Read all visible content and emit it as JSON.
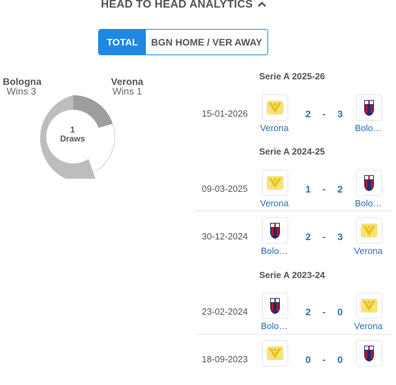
{
  "header": {
    "title": "HEAD TO HEAD ANALYTICS"
  },
  "tabs": [
    {
      "label": "TOTAL"
    },
    {
      "label": "BGN HOME / VER AWAY"
    }
  ],
  "summary": {
    "home": {
      "name": "Bologna",
      "wins": "Wins 3"
    },
    "away": {
      "name": "Verona",
      "wins": "Wins 1"
    },
    "draws": {
      "count": "1",
      "label": "Draws"
    }
  },
  "seasons": [
    {
      "name": "Serie A 2025-26"
    },
    {
      "name": "Serie A 2024-25"
    },
    {
      "name": "Serie A 2023-24"
    }
  ],
  "matches": [
    {
      "date": "15-01-2026",
      "home": "Verona",
      "away": "Bolo…",
      "home_score": "2",
      "away_score": "3",
      "dash": "-"
    },
    {
      "date": "09-03-2025",
      "home": "Verona",
      "away": "Bolo…",
      "home_score": "1",
      "away_score": "2",
      "dash": "-"
    },
    {
      "date": "30-12-2024",
      "home": "Bolo…",
      "away": "Verona",
      "home_score": "2",
      "away_score": "3",
      "dash": "-"
    },
    {
      "date": "23-02-2024",
      "home": "Bolo…",
      "away": "Verona",
      "home_score": "2",
      "away_score": "0",
      "dash": "-"
    },
    {
      "date": "18-09-2023",
      "home": "",
      "away": "",
      "home_score": "0",
      "away_score": "0",
      "dash": "-"
    }
  ],
  "colors": {
    "accent": "#1e88e5",
    "link": "#2a6ebb",
    "bologna_wins": "#bdbdbd",
    "verona_wins": "#9e9e9e",
    "draws": "#ffffff"
  }
}
